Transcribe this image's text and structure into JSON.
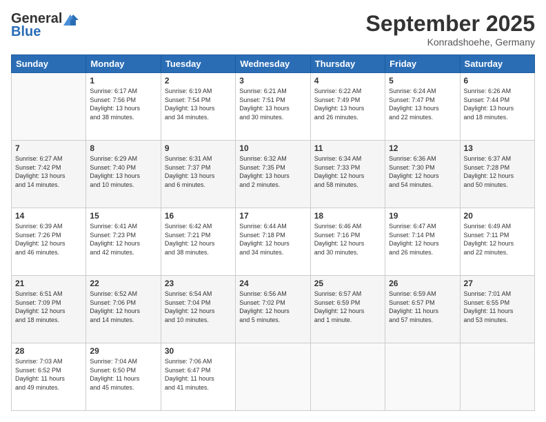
{
  "header": {
    "logo_line1": "General",
    "logo_line2": "Blue",
    "month": "September 2025",
    "location": "Konradshoehe, Germany"
  },
  "weekdays": [
    "Sunday",
    "Monday",
    "Tuesday",
    "Wednesday",
    "Thursday",
    "Friday",
    "Saturday"
  ],
  "weeks": [
    [
      {
        "day": "",
        "info": ""
      },
      {
        "day": "1",
        "info": "Sunrise: 6:17 AM\nSunset: 7:56 PM\nDaylight: 13 hours\nand 38 minutes."
      },
      {
        "day": "2",
        "info": "Sunrise: 6:19 AM\nSunset: 7:54 PM\nDaylight: 13 hours\nand 34 minutes."
      },
      {
        "day": "3",
        "info": "Sunrise: 6:21 AM\nSunset: 7:51 PM\nDaylight: 13 hours\nand 30 minutes."
      },
      {
        "day": "4",
        "info": "Sunrise: 6:22 AM\nSunset: 7:49 PM\nDaylight: 13 hours\nand 26 minutes."
      },
      {
        "day": "5",
        "info": "Sunrise: 6:24 AM\nSunset: 7:47 PM\nDaylight: 13 hours\nand 22 minutes."
      },
      {
        "day": "6",
        "info": "Sunrise: 6:26 AM\nSunset: 7:44 PM\nDaylight: 13 hours\nand 18 minutes."
      }
    ],
    [
      {
        "day": "7",
        "info": "Sunrise: 6:27 AM\nSunset: 7:42 PM\nDaylight: 13 hours\nand 14 minutes."
      },
      {
        "day": "8",
        "info": "Sunrise: 6:29 AM\nSunset: 7:40 PM\nDaylight: 13 hours\nand 10 minutes."
      },
      {
        "day": "9",
        "info": "Sunrise: 6:31 AM\nSunset: 7:37 PM\nDaylight: 13 hours\nand 6 minutes."
      },
      {
        "day": "10",
        "info": "Sunrise: 6:32 AM\nSunset: 7:35 PM\nDaylight: 13 hours\nand 2 minutes."
      },
      {
        "day": "11",
        "info": "Sunrise: 6:34 AM\nSunset: 7:33 PM\nDaylight: 12 hours\nand 58 minutes."
      },
      {
        "day": "12",
        "info": "Sunrise: 6:36 AM\nSunset: 7:30 PM\nDaylight: 12 hours\nand 54 minutes."
      },
      {
        "day": "13",
        "info": "Sunrise: 6:37 AM\nSunset: 7:28 PM\nDaylight: 12 hours\nand 50 minutes."
      }
    ],
    [
      {
        "day": "14",
        "info": "Sunrise: 6:39 AM\nSunset: 7:26 PM\nDaylight: 12 hours\nand 46 minutes."
      },
      {
        "day": "15",
        "info": "Sunrise: 6:41 AM\nSunset: 7:23 PM\nDaylight: 12 hours\nand 42 minutes."
      },
      {
        "day": "16",
        "info": "Sunrise: 6:42 AM\nSunset: 7:21 PM\nDaylight: 12 hours\nand 38 minutes."
      },
      {
        "day": "17",
        "info": "Sunrise: 6:44 AM\nSunset: 7:18 PM\nDaylight: 12 hours\nand 34 minutes."
      },
      {
        "day": "18",
        "info": "Sunrise: 6:46 AM\nSunset: 7:16 PM\nDaylight: 12 hours\nand 30 minutes."
      },
      {
        "day": "19",
        "info": "Sunrise: 6:47 AM\nSunset: 7:14 PM\nDaylight: 12 hours\nand 26 minutes."
      },
      {
        "day": "20",
        "info": "Sunrise: 6:49 AM\nSunset: 7:11 PM\nDaylight: 12 hours\nand 22 minutes."
      }
    ],
    [
      {
        "day": "21",
        "info": "Sunrise: 6:51 AM\nSunset: 7:09 PM\nDaylight: 12 hours\nand 18 minutes."
      },
      {
        "day": "22",
        "info": "Sunrise: 6:52 AM\nSunset: 7:06 PM\nDaylight: 12 hours\nand 14 minutes."
      },
      {
        "day": "23",
        "info": "Sunrise: 6:54 AM\nSunset: 7:04 PM\nDaylight: 12 hours\nand 10 minutes."
      },
      {
        "day": "24",
        "info": "Sunrise: 6:56 AM\nSunset: 7:02 PM\nDaylight: 12 hours\nand 5 minutes."
      },
      {
        "day": "25",
        "info": "Sunrise: 6:57 AM\nSunset: 6:59 PM\nDaylight: 12 hours\nand 1 minute."
      },
      {
        "day": "26",
        "info": "Sunrise: 6:59 AM\nSunset: 6:57 PM\nDaylight: 11 hours\nand 57 minutes."
      },
      {
        "day": "27",
        "info": "Sunrise: 7:01 AM\nSunset: 6:55 PM\nDaylight: 11 hours\nand 53 minutes."
      }
    ],
    [
      {
        "day": "28",
        "info": "Sunrise: 7:03 AM\nSunset: 6:52 PM\nDaylight: 11 hours\nand 49 minutes."
      },
      {
        "day": "29",
        "info": "Sunrise: 7:04 AM\nSunset: 6:50 PM\nDaylight: 11 hours\nand 45 minutes."
      },
      {
        "day": "30",
        "info": "Sunrise: 7:06 AM\nSunset: 6:47 PM\nDaylight: 11 hours\nand 41 minutes."
      },
      {
        "day": "",
        "info": ""
      },
      {
        "day": "",
        "info": ""
      },
      {
        "day": "",
        "info": ""
      },
      {
        "day": "",
        "info": ""
      }
    ]
  ]
}
